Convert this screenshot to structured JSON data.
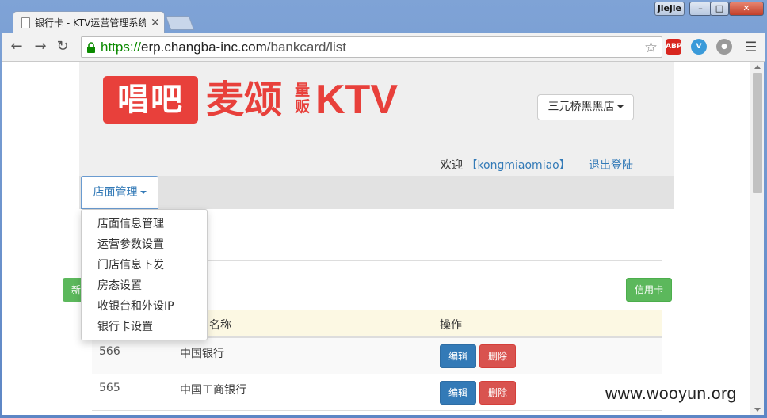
{
  "browser": {
    "tab_title": "银行卡 - KTV运营管理系统",
    "user_badge": "jiejie",
    "url_scheme": "https://",
    "url_host": "erp.changba-inc.com",
    "url_path": "/bankcard/list",
    "extensions": [
      "abp-icon",
      "v-icon",
      "globe-icon"
    ]
  },
  "header": {
    "logo_main": "唱吧",
    "logo_brand": "麦颂",
    "logo_small": "量贩",
    "logo_ktv": "KTV",
    "store_select": "三元桥黑黑店",
    "welcome_prefix": "欢迎",
    "username": "【kongmiaomiao】",
    "logout": "退出登陆"
  },
  "nav": {
    "dropdown_label": "店面管理",
    "menu_items": [
      "店面信息管理",
      "运营参数设置",
      "门店信息下发",
      "房态设置",
      "收银台和外设IP",
      "银行卡设置"
    ]
  },
  "actions": {
    "new_button_partial": "新增",
    "credit_button": "信用卡"
  },
  "table": {
    "header_name": "名称",
    "header_op": "操作",
    "rows": [
      {
        "id": "566",
        "name": "中国银行",
        "edit": "编辑",
        "delete": "删除"
      },
      {
        "id": "565",
        "name": "中国工商银行",
        "edit": "编辑",
        "delete": "删除"
      }
    ]
  },
  "watermark": "www.wooyun.org",
  "colors": {
    "brand_red": "#e8403b",
    "link_blue": "#337ab7",
    "success_green": "#5cb85c",
    "danger_red": "#d9534f"
  }
}
